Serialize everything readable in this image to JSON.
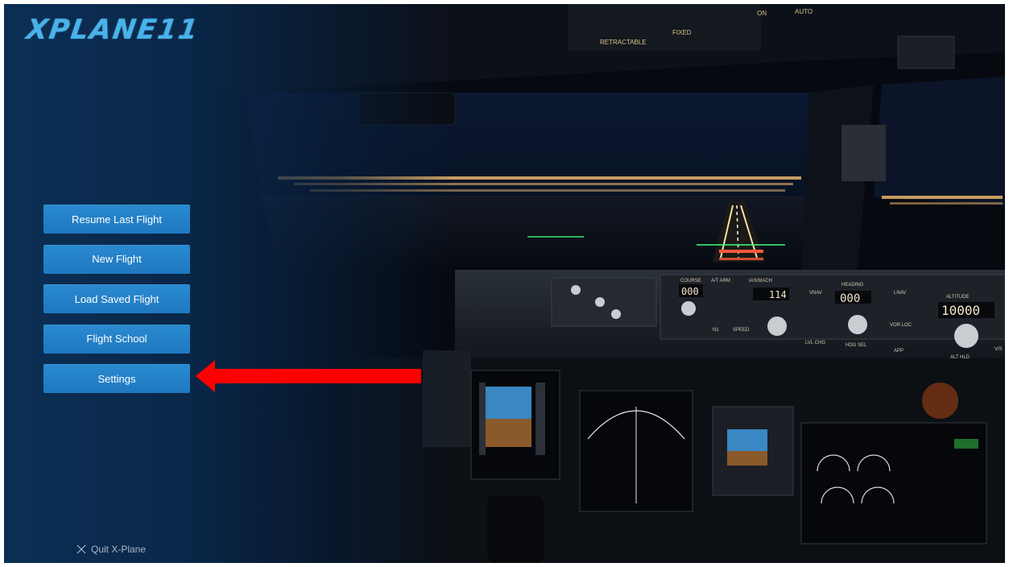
{
  "app": {
    "logo_text": "XPLANE11"
  },
  "menu": {
    "items": [
      {
        "label": "Resume Last Flight"
      },
      {
        "label": "New Flight"
      },
      {
        "label": "Load Saved Flight"
      },
      {
        "label": "Flight School"
      },
      {
        "label": "Settings"
      }
    ]
  },
  "quit": {
    "label": "Quit X-Plane",
    "icon": "close-icon"
  },
  "annotation": {
    "type": "arrow",
    "color": "#ff0000",
    "points_to": "Settings"
  },
  "cockpit": {
    "overhead_labels": [
      "RETRACTABLE",
      "FIXED",
      "ON",
      "AUTO"
    ],
    "mcp_labels": [
      "COURSE",
      "A/T ARM",
      "IAS/MACH",
      "HEADING",
      "ALTITUDE",
      "VNAV",
      "LNAV",
      "VOR LOC",
      "APP",
      "ALT HLD",
      "SPEED",
      "N1",
      "LVL CHG",
      "HDG SEL",
      "V/S"
    ],
    "course_value": "000",
    "ias_value": "114",
    "heading_value": "000",
    "altitude_value": "10000"
  },
  "colors": {
    "button": "#2280c6",
    "logo": "#48b3ea",
    "arrow": "#ff0000"
  }
}
